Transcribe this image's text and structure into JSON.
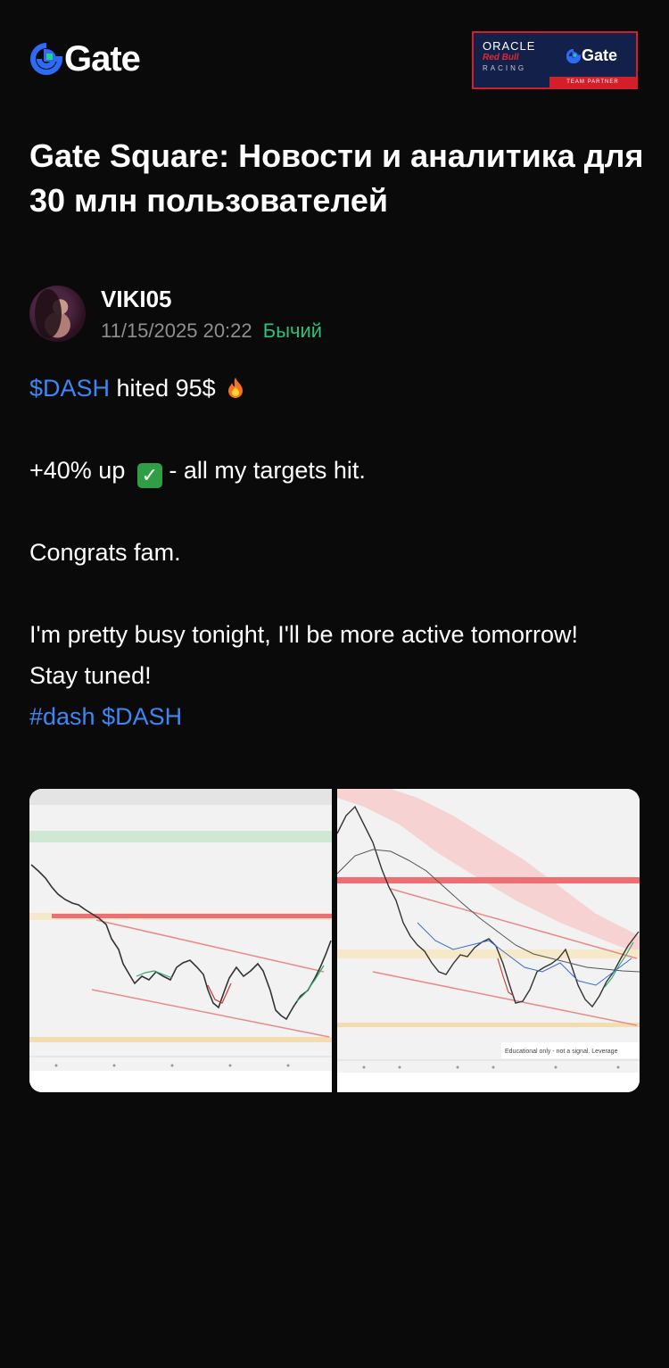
{
  "header": {
    "logo_text": "Gate",
    "logo_icon": "gate-logo-icon",
    "partner": {
      "oracle": "ORACLE",
      "redbull": "Red Bull",
      "racing": "RACING",
      "gate": "Gate",
      "strip": "TEAM PARTNER"
    }
  },
  "headline": "Gate Square: Новости и аналитика для 30 млн пользователей",
  "author": {
    "name": "VIKI05",
    "date": "11/15/2025 20:22",
    "sentiment": "Бычий"
  },
  "post": {
    "line1_tag": "$DASH",
    "line1_text": " hited 95$",
    "line2_text": "+40% up",
    "line2_rest": "  - all my targets hit.",
    "line3": "Congrats fam.",
    "line4": "I'm pretty busy tonight, I'll be more active tomorrow!",
    "line5": "Stay tuned!",
    "hashtag": "#dash",
    "cashtag2": "$DASH"
  },
  "images": [
    {
      "name": "dash-chart-1"
    },
    {
      "name": "dash-chart-2",
      "caption": "Educational only - not a signal. Leverage"
    }
  ],
  "colors": {
    "background": "#0a0a0b",
    "accent_blue": "#3f86f3",
    "bullish_green": "#2fbf7a",
    "muted": "#8e8e93"
  }
}
